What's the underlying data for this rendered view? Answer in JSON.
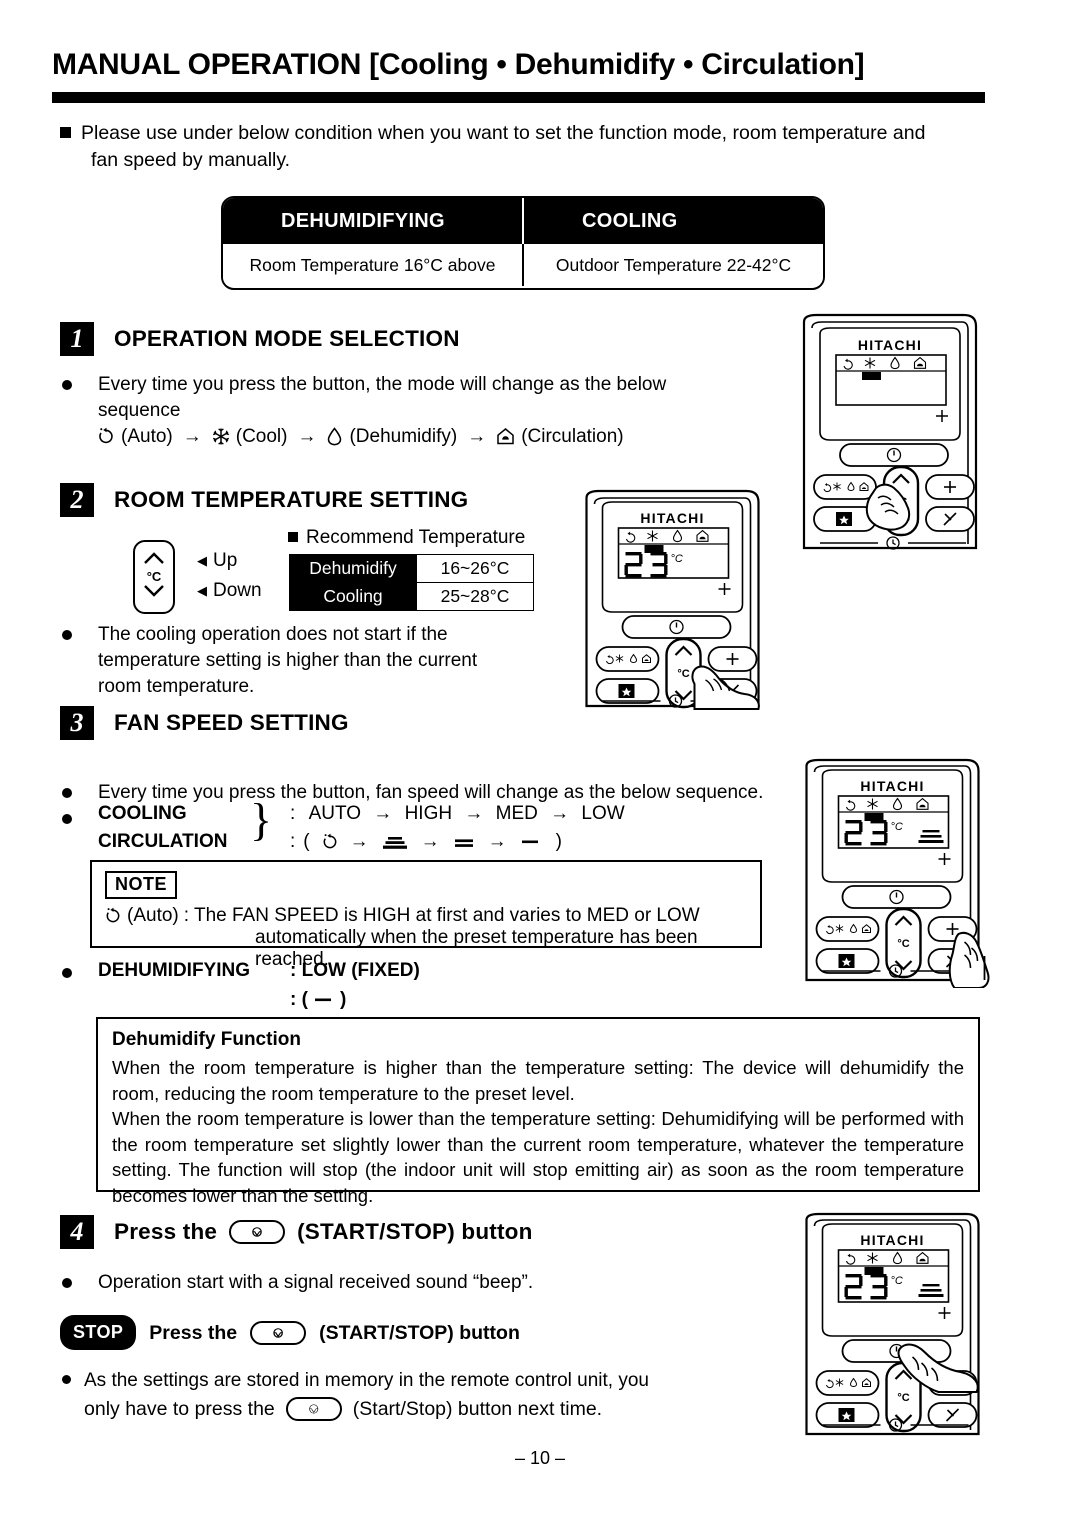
{
  "header": {
    "title_main": "MANUAL OPERATION",
    "title_bracket": "[Cooling • Dehumidify • Circulation]"
  },
  "intro": {
    "line1": "Please use under below condition when you want to set the function mode, room temperature and",
    "line2": "fan speed by manually."
  },
  "condition_table": {
    "headers": [
      "DEHUMIDIFYING",
      "COOLING"
    ],
    "values": [
      "Room Temperature 16°C above",
      "Outdoor Temperature 22-42°C"
    ]
  },
  "step1": {
    "number": "1",
    "title": "OPERATION MODE SELECTION",
    "bullet1_line1": "Every time you press the button, the mode will change as the below",
    "bullet1_line2": "sequence",
    "sequence": [
      {
        "icon": "auto-circle-icon",
        "label": "(Auto)"
      },
      {
        "icon": "snowflake-icon",
        "label": "(Cool)"
      },
      {
        "icon": "water-drop-icon",
        "label": "(Dehumidify)"
      },
      {
        "icon": "circulation-house-icon",
        "label": "(Circulation)"
      }
    ],
    "arrow": "→"
  },
  "step2": {
    "number": "2",
    "title": "ROOM TEMPERATURE SETTING",
    "button_unit": "°C",
    "up_label": "Up",
    "down_label": "Down",
    "triangle": "◀",
    "recommend_title": "Recommend Temperature",
    "recommend_rows": [
      {
        "mode": "Dehumidify",
        "range": "16~26°C"
      },
      {
        "mode": "Cooling",
        "range": "25~28°C"
      }
    ],
    "bullet_line1": "The cooling operation does not start if the",
    "bullet_line2": "temperature setting is higher than the current",
    "bullet_line3": "room temperature."
  },
  "step3": {
    "number": "3",
    "title": "FAN SPEED SETTING",
    "bullet1": "Every time you press the button, fan speed will change as the below sequence.",
    "mode_names": [
      "COOLING",
      "CIRCULATION"
    ],
    "brace": "}",
    "colon": ":",
    "speed_words": [
      "AUTO",
      "HIGH",
      "MED",
      "LOW"
    ],
    "arrow": "→",
    "paren_open": "(",
    "paren_close": ")",
    "note": {
      "tag": "NOTE",
      "auto_label": "(Auto)",
      "line1": ": The  FAN  SPEED  is  HIGH  at  first  and  varies  to  MED  or  LOW",
      "line2": "automatically when the preset temperature has been reached."
    },
    "dehumidifying_label": "DEHUMIDIFYING",
    "dehumidifying_value": ":  LOW (FIXED)",
    "dehumidifying_symbol_pre": ":  (",
    "dehumidifying_symbol_post": ")"
  },
  "dehumidify_function": {
    "title": "Dehumidify Function",
    "para1": "When the room temperature is higher than the temperature setting: The device will dehumidify the room, reducing the room temperature to the preset level.",
    "para2": "When the room temperature is lower than the temperature setting: Dehumidifying will be performed with the room temperature set slightly lower than the current room temperature, whatever the temperature setting. The function will stop (the indoor unit will stop emitting air) as soon as the room temperature becomes lower than the setting."
  },
  "step4": {
    "number": "4",
    "title_pre": "Press the",
    "title_post": "(START/STOP) button",
    "bullet1": "Operation start with a signal received sound “beep”.",
    "stop_badge": "STOP",
    "stop_line_pre": "Press the",
    "stop_line_post": "(START/STOP) button",
    "memory_line1": "As the settings are stored in memory in the remote control unit, you",
    "memory_line2_pre": "only have to press the",
    "memory_line2_post": "(Start/Stop) button next time."
  },
  "remotes": [
    {
      "id": "remote-step1",
      "brand": "HITACHI",
      "lcd_temp": "",
      "lcd_unit": "",
      "show_fan_bars": false,
      "highlight_mode_index": 1,
      "pointing_at": "mode-button"
    },
    {
      "id": "remote-step2",
      "brand": "HITACHI",
      "lcd_temp": "23",
      "lcd_unit": "°C",
      "show_fan_bars": false,
      "highlight_mode_index": 1,
      "pointing_at": "temp-button"
    },
    {
      "id": "remote-step3",
      "brand": "HITACHI",
      "lcd_temp": "23",
      "lcd_unit": "°C",
      "show_fan_bars": true,
      "highlight_mode_index": 1,
      "pointing_at": "fan-button"
    },
    {
      "id": "remote-step4",
      "brand": "HITACHI",
      "lcd_temp": "23",
      "lcd_unit": "°C",
      "show_fan_bars": true,
      "highlight_mode_index": 1,
      "pointing_at": "start-stop-button"
    }
  ],
  "footer": {
    "page_number": "– 10 –"
  },
  "colors": {
    "ink": "#000000",
    "paper": "#ffffff"
  }
}
